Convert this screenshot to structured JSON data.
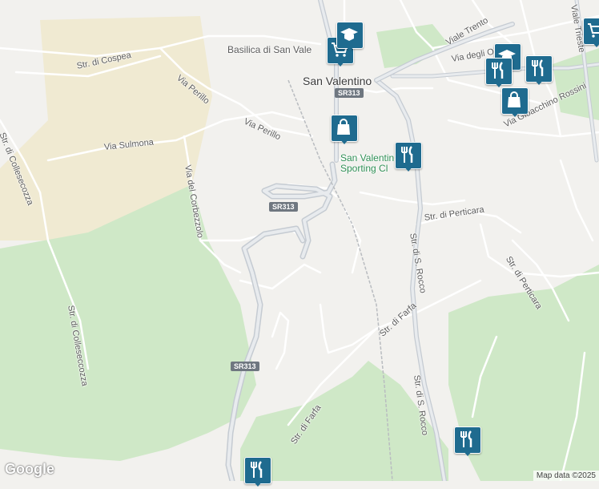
{
  "map": {
    "place_name": "San Valentino",
    "poi_label_line1": "San Valentin",
    "poi_label_line2": "Sporting Cl",
    "basilica_label": "Basilica di San Vale",
    "routes": [
      "SR313",
      "SR313",
      "SR313"
    ],
    "streets": {
      "str_di_cospea": "Str. di Cospea",
      "via_perillo_1": "Via Perillo",
      "via_perillo_2": "Via Perillo",
      "via_sulmona": "Via Sulmona",
      "str_di_collesecozza": "Str. di Collesecozza",
      "via_del_corbezzolo": "Via del Corbezzolo",
      "str_di_colleseccozza": "Str. di Colleseccozza",
      "str_di_farfa_1": "Str. di Farfa",
      "str_di_farfa_2": "Str. di Farfa",
      "str_di_s_rocco_1": "Str. di S. Rocco",
      "str_di_s_rocco_2": "Str. di S. Rocco",
      "str_di_perticara_1": "Str. di Perticara",
      "str_di_perticara_2": "Str. di Perticara",
      "viale_trento": "Viale Trento",
      "viale_trieste": "Viale Trieste",
      "via_degli_oleandri": "Via degli Oleandri",
      "via_gioacchino_rossini": "Via Gioacchino Rossini"
    },
    "markers": [
      {
        "type": "shopping-cart",
        "name": "cart-marker"
      },
      {
        "type": "school",
        "name": "school-marker"
      },
      {
        "type": "shopping-bag",
        "name": "bag-marker-1"
      },
      {
        "type": "restaurant",
        "name": "restaurant-marker-1"
      },
      {
        "type": "school",
        "name": "school-marker-2"
      },
      {
        "type": "restaurant",
        "name": "restaurant-marker-2"
      },
      {
        "type": "restaurant",
        "name": "restaurant-marker-3"
      },
      {
        "type": "shopping-bag",
        "name": "bag-marker-2"
      },
      {
        "type": "restaurant",
        "name": "restaurant-marker-4"
      },
      {
        "type": "restaurant",
        "name": "restaurant-marker-5"
      },
      {
        "type": "shopping-cart",
        "name": "cart-marker-2"
      }
    ],
    "colors": {
      "marker": "#1f6b8f",
      "park": "#cfe8c7",
      "sand": "#f0ead2",
      "road": "#ffffff",
      "main_road": "#c8cdd3"
    }
  },
  "footer": {
    "logo": "Google",
    "attribution": "Map data ©2025"
  }
}
